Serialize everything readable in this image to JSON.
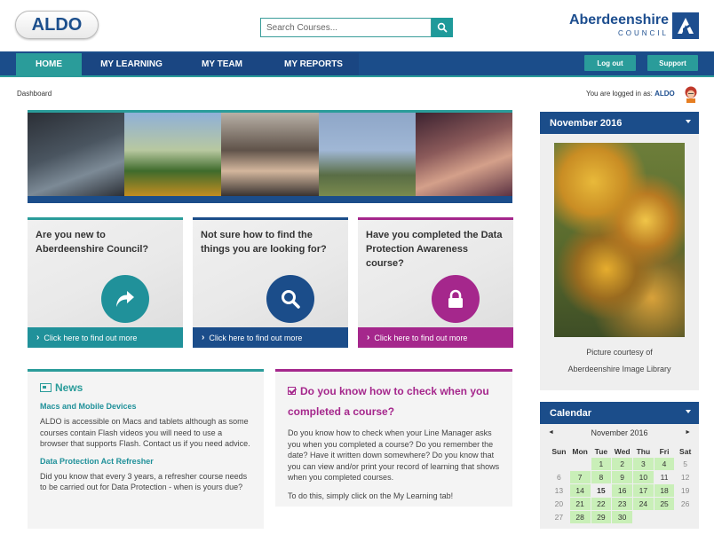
{
  "header": {
    "logo": "ALDO",
    "search_placeholder": "Search Courses...",
    "council_name": "Aberdeenshire",
    "council_sub": "COUNCIL"
  },
  "nav": {
    "items": [
      "HOME",
      "MY LEARNING",
      "MY TEAM",
      "MY REPORTS"
    ],
    "logout": "Log out",
    "support": "Support"
  },
  "breadcrumb": "Dashboard",
  "login": {
    "prefix": "You are logged in as:",
    "user": "ALDO"
  },
  "cards": [
    {
      "title": "Are you new to Aberdeenshire Council?",
      "icon": "share-arrow-icon",
      "link": "Click here to find out more"
    },
    {
      "title": "Not sure how to find the things you are looking for?",
      "icon": "search-icon",
      "link": "Click here to find out more"
    },
    {
      "title": "Have you completed the Data Protection Awareness course?",
      "icon": "lock-icon",
      "link": "Click here to find out more"
    }
  ],
  "news": {
    "heading": "News",
    "items": [
      {
        "title": "Macs and Mobile Devices",
        "body": "ALDO is accessible on Macs and tablets although as some courses contain Flash videos you will need to use a browser that supports Flash. Contact us if you need advice."
      },
      {
        "title": "Data Protection Act Refresher",
        "body": "Did you know that every 3 years, a refresher course needs to be carried out for Data Protection - when is yours due?"
      }
    ]
  },
  "check": {
    "heading": "Do you know how to check when you completed a course?",
    "body": "Do you know how to check when you completed a course?",
    "para1": "Do you know how to check when your Line Manager asks you when you completed a course? Do you remember the date? Have it written down somewhere? Do you know that you can view and/or print your record of learning that shows when you completed courses.",
    "para2": "To do this, simply click on the My Learning tab!"
  },
  "month_widget": {
    "title": "November 2016",
    "caption1": "Picture courtesy of",
    "caption2": "Aberdeenshire Image Library"
  },
  "calendar": {
    "title": "Calendar",
    "month": "November 2016",
    "prev": "◄",
    "next": "►",
    "weekdays": [
      "Sun",
      "Mon",
      "Tue",
      "Wed",
      "Thu",
      "Fri",
      "Sat"
    ],
    "weeks": [
      [
        "",
        "",
        "1",
        "2",
        "3",
        "4",
        "5"
      ],
      [
        "6",
        "7",
        "8",
        "9",
        "10",
        "11",
        "12"
      ],
      [
        "13",
        "14",
        "15",
        "16",
        "17",
        "18",
        "19"
      ],
      [
        "20",
        "21",
        "22",
        "23",
        "24",
        "25",
        "26"
      ],
      [
        "27",
        "28",
        "29",
        "30",
        "",
        "",
        ""
      ]
    ]
  }
}
